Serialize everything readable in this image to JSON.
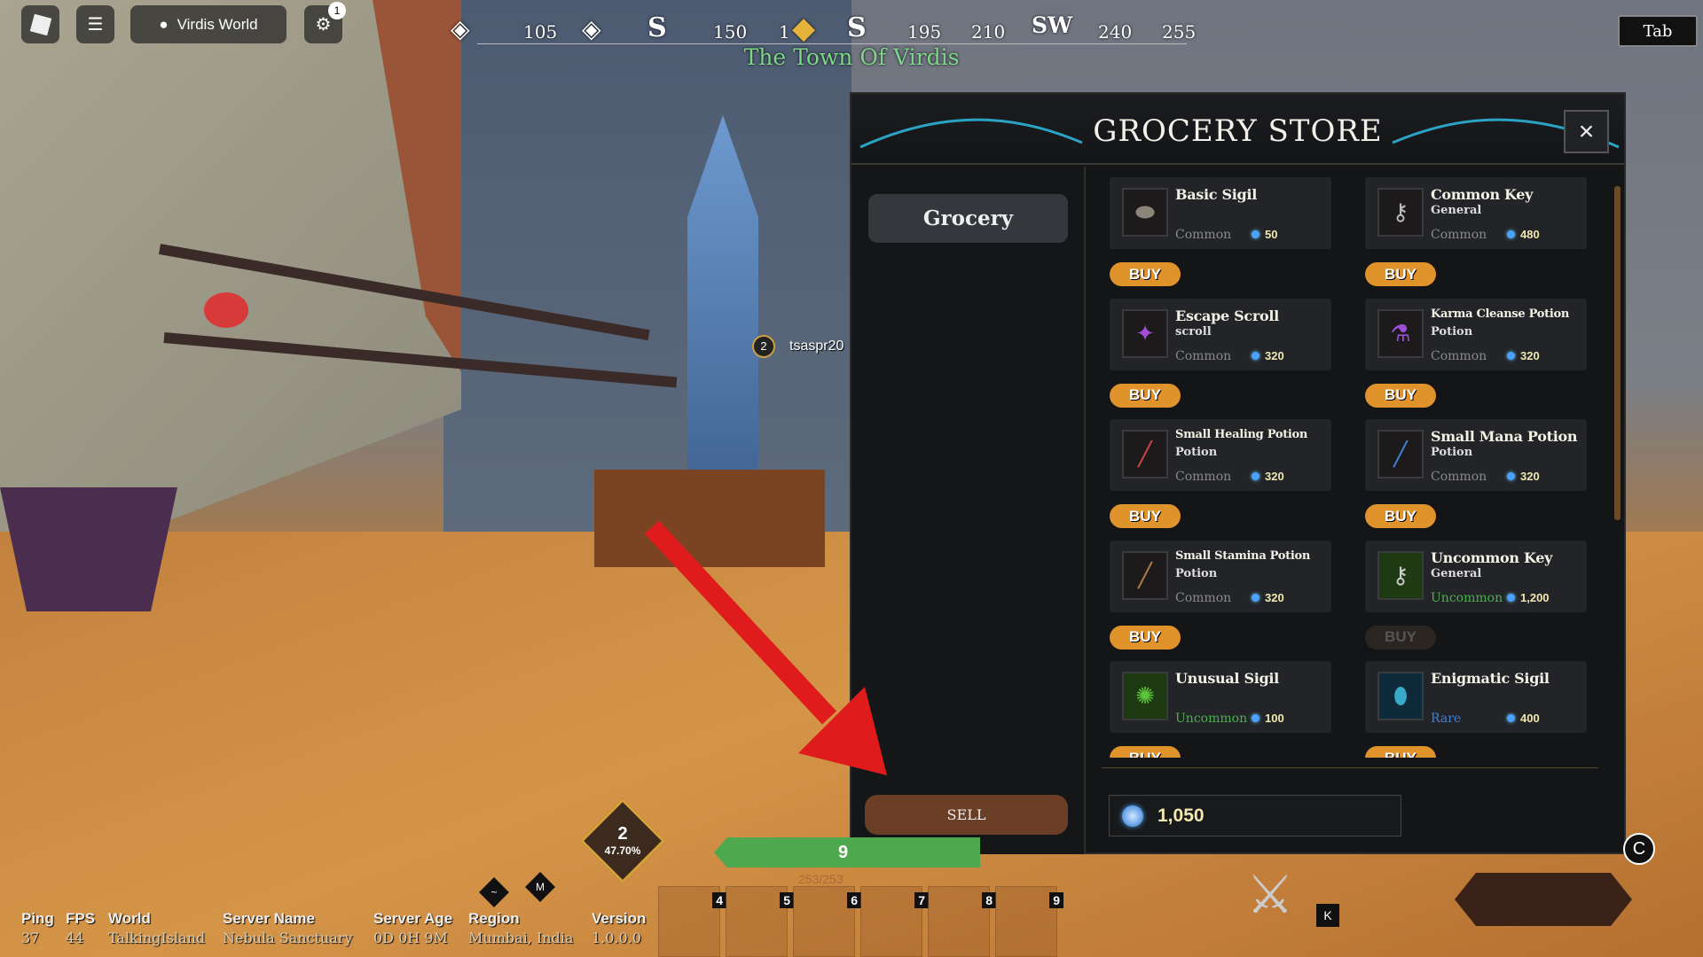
{
  "topbar": {
    "world_button": "Virdis World",
    "notification_count": "1",
    "tab_button": "Tab"
  },
  "compass": {
    "marks": [
      "105",
      "S",
      "150",
      "1",
      "S",
      "195",
      "210",
      "SW",
      "240",
      "255"
    ],
    "location": "The Town Of Virdis"
  },
  "nameplate": {
    "level": "2",
    "player": "tsaspr20"
  },
  "store": {
    "title": "GROCERY STORE",
    "close_icon": "×",
    "categories": [
      {
        "label": "Grocery"
      }
    ],
    "sell_label": "SELL",
    "currency_balance": "1,050",
    "items": [
      {
        "name": "Basic Sigil",
        "category": "",
        "rarity": "Common",
        "price": "50",
        "buy": "BUY",
        "buy_enabled": true,
        "rarity_color": "#8a8a8a"
      },
      {
        "name": "Common Key",
        "category": "General",
        "rarity": "Common",
        "price": "480",
        "buy": "BUY",
        "buy_enabled": true,
        "rarity_color": "#8a8a8a"
      },
      {
        "name": "Escape Scroll",
        "category": "scroll",
        "rarity": "Common",
        "price": "320",
        "buy": "BUY",
        "buy_enabled": true,
        "rarity_color": "#8a8a8a"
      },
      {
        "name": "Karma Cleanse Potion",
        "category": "Potion",
        "rarity": "Common",
        "price": "320",
        "buy": "BUY",
        "buy_enabled": true,
        "rarity_color": "#8a8a8a"
      },
      {
        "name": "Small Healing Potion",
        "category": "Potion",
        "rarity": "Common",
        "price": "320",
        "buy": "BUY",
        "buy_enabled": true,
        "rarity_color": "#8a8a8a"
      },
      {
        "name": "Small Mana Potion",
        "category": "Potion",
        "rarity": "Common",
        "price": "320",
        "buy": "BUY",
        "buy_enabled": true,
        "rarity_color": "#8a8a8a"
      },
      {
        "name": "Small Stamina Potion",
        "category": "Potion",
        "rarity": "Common",
        "price": "320",
        "buy": "BUY",
        "buy_enabled": true,
        "rarity_color": "#8a8a8a"
      },
      {
        "name": "Uncommon Key",
        "category": "General",
        "rarity": "Uncommon",
        "price": "1,200",
        "buy": "BUY",
        "buy_enabled": false,
        "rarity_color": "#4caf50"
      },
      {
        "name": "Unusual Sigil",
        "category": "",
        "rarity": "Uncommon",
        "price": "100",
        "buy": "BUY",
        "buy_enabled": true,
        "rarity_color": "#4caf50"
      },
      {
        "name": "Enigmatic Sigil",
        "category": "",
        "rarity": "Rare",
        "price": "400",
        "buy": "BUY",
        "buy_enabled": true,
        "rarity_color": "#3f7fd6"
      }
    ]
  },
  "hud": {
    "level": "2",
    "xp_percent": "47.70%",
    "health_text": "9",
    "stamina_text": "253/253",
    "hotkey_tilde": "~",
    "hotkey_m": "M",
    "hotkey_k": "K",
    "hotkey_c": "C",
    "hotbar": [
      "4",
      "5",
      "6",
      "7",
      "8",
      "9"
    ]
  },
  "stats": [
    {
      "label": "Ping",
      "value": "37"
    },
    {
      "label": "FPS",
      "value": "44"
    },
    {
      "label": "World",
      "value": "TalkingIsland"
    },
    {
      "label": "Server Name",
      "value": "Nebula Sanctuary"
    },
    {
      "label": "Server Age",
      "value": "0D 0H 9M"
    },
    {
      "label": "Region",
      "value": "Mumbai, India"
    },
    {
      "label": "Version",
      "value": "1.0.0.0"
    }
  ],
  "colors": {
    "buy": "#e0922b",
    "sell": "#6a3f26",
    "panel": "#141517",
    "arrow": "#e01b1b"
  }
}
